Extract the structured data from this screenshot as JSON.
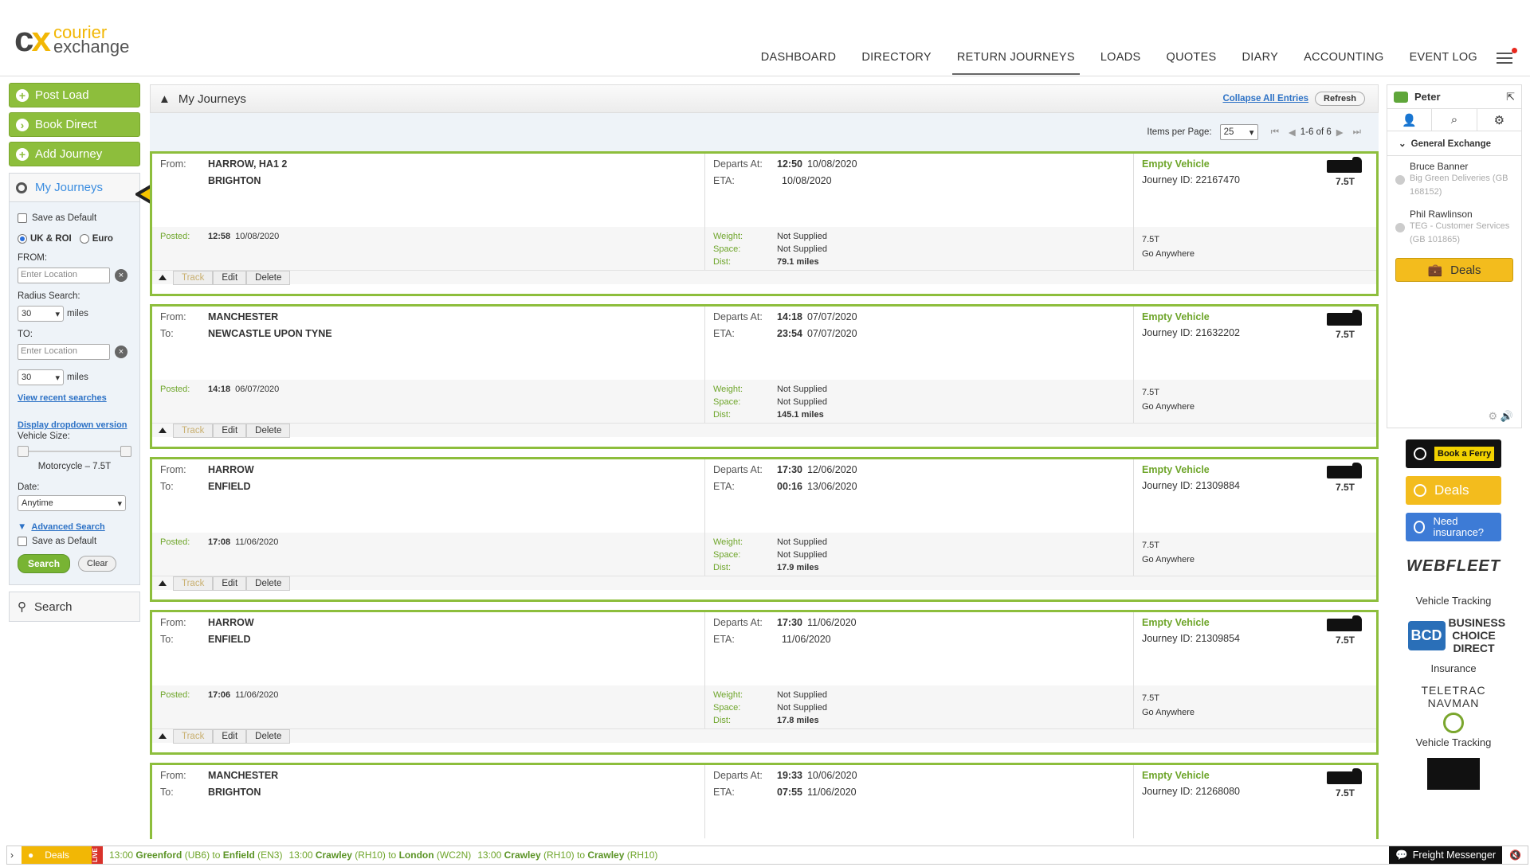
{
  "brand": {
    "cx": "cx",
    "line1": "courier",
    "line2": "exchange"
  },
  "nav": [
    {
      "label": "DASHBOARD"
    },
    {
      "label": "DIRECTORY"
    },
    {
      "label": "RETURN JOURNEYS",
      "active": true
    },
    {
      "label": "LOADS"
    },
    {
      "label": "QUOTES"
    },
    {
      "label": "DIARY"
    },
    {
      "label": "ACCOUNTING"
    },
    {
      "label": "EVENT LOG"
    }
  ],
  "sidebar": {
    "buttons": [
      "Post Load",
      "Book Direct",
      "Add Journey"
    ],
    "panel_title": "My Journeys",
    "save_default": "Save as Default",
    "uk_label": "UK & ROI",
    "euro_label": "Euro",
    "from_label": "FROM:",
    "from_placeholder": "Enter Location",
    "radius_label": "Radius Search:",
    "radius_value": "30",
    "miles": "miles",
    "to_label": "TO:",
    "to_placeholder": "Enter Location",
    "to_radius": "30",
    "recent": "View recent searches",
    "dropdown": "Display dropdown version",
    "vehicle_label": "Vehicle Size:",
    "vehicle_range": "Motorcycle – 7.5T",
    "date_label": "Date:",
    "date_value": "Anytime",
    "advanced": "Advanced Search",
    "save_default2": "Save as Default",
    "search_btn": "Search",
    "clear_btn": "Clear",
    "search_panel": "Search"
  },
  "main": {
    "title": "My Journeys",
    "collapse": "Collapse All Entries",
    "refresh": "Refresh",
    "per_page_label": "Items per Page:",
    "per_page": "25",
    "range": "1-6 of 6"
  },
  "labels": {
    "from": "From:",
    "to": "To:",
    "departs": "Departs At:",
    "eta": "ETA:",
    "posted": "Posted:",
    "weight": "Weight:",
    "space": "Space:",
    "dist": "Dist:",
    "track": "Track",
    "edit": "Edit",
    "delete": "Delete"
  },
  "journeys": [
    {
      "from": "HARROW, HA1 2",
      "to": "BRIGHTON",
      "to_label": "",
      "dep_time": "12:50",
      "dep_date": "10/08/2020",
      "eta_time": "",
      "eta_date": "10/08/2020",
      "posted_time": "12:58",
      "posted_date": "10/08/2020",
      "weight": "Not Supplied",
      "space": "Not Supplied",
      "dist": "79.1 miles",
      "status": "Empty Vehicle",
      "jid": "Journey ID: 22167470",
      "size": "7.5T",
      "vsize": "7.5T",
      "note": "Go Anywhere"
    },
    {
      "from": "MANCHESTER",
      "to": "NEWCASTLE UPON TYNE",
      "to_label": "To:",
      "dep_time": "14:18",
      "dep_date": "07/07/2020",
      "eta_time": "23:54",
      "eta_date": "07/07/2020",
      "posted_time": "14:18",
      "posted_date": "06/07/2020",
      "weight": "Not Supplied",
      "space": "Not Supplied",
      "dist": "145.1 miles",
      "status": "Empty Vehicle",
      "jid": "Journey ID: 21632202",
      "size": "7.5T",
      "vsize": "7.5T",
      "note": "Go Anywhere"
    },
    {
      "from": "HARROW",
      "to": "ENFIELD",
      "to_label": "To:",
      "dep_time": "17:30",
      "dep_date": "12/06/2020",
      "eta_time": "00:16",
      "eta_date": "13/06/2020",
      "posted_time": "17:08",
      "posted_date": "11/06/2020",
      "weight": "Not Supplied",
      "space": "Not Supplied",
      "dist": "17.9 miles",
      "status": "Empty Vehicle",
      "jid": "Journey ID: 21309884",
      "size": "7.5T",
      "vsize": "7.5T",
      "note": "Go Anywhere"
    },
    {
      "from": "HARROW",
      "to": "ENFIELD",
      "to_label": "To:",
      "dep_time": "17:30",
      "dep_date": "11/06/2020",
      "eta_time": "",
      "eta_date": "11/06/2020",
      "posted_time": "17:06",
      "posted_date": "11/06/2020",
      "weight": "Not Supplied",
      "space": "Not Supplied",
      "dist": "17.8 miles",
      "status": "Empty Vehicle",
      "jid": "Journey ID: 21309854",
      "size": "7.5T",
      "vsize": "7.5T",
      "note": "Go Anywhere"
    },
    {
      "from": "MANCHESTER",
      "to": "BRIGHTON",
      "to_label": "To:",
      "dep_time": "19:33",
      "dep_date": "10/06/2020",
      "eta_time": "07:55",
      "eta_date": "11/06/2020",
      "posted_time": "",
      "posted_date": "",
      "weight": "",
      "space": "",
      "dist": "",
      "status": "Empty Vehicle",
      "jid": "Journey ID: 21268080",
      "size": "7.5T",
      "vsize": "",
      "note": ""
    }
  ],
  "chat": {
    "user": "Peter",
    "group": "General Exchange",
    "contacts": [
      {
        "name": "Bruce Banner",
        "sub": "Big Green Deliveries (GB 168152)"
      },
      {
        "name": "Phil Rawlinson",
        "sub": "TEG - Customer Services (GB 101865)"
      }
    ],
    "deals": "Deals"
  },
  "ads": {
    "ferry": "Book a Ferry",
    "deals": "Deals",
    "insurance": "Need insurance?",
    "webfleet": "WEBFLEET",
    "webfleet_sub": "Vehicle Tracking",
    "bcd": "BCD",
    "bcd_text": "BUSINESS CHOICE DIRECT",
    "bcd_sub": "Insurance",
    "teletrac": "TELETRAC NAVMAN",
    "teletrac_sub": "Vehicle Tracking"
  },
  "ticker": {
    "deals": "Deals",
    "live": "LIVE",
    "messenger": "Freight Messenger",
    "items": [
      {
        "time": "13:00",
        "from": "Greenford",
        "fpc": "(UB6)",
        "to": "Enfield",
        "tpc": "(EN3)"
      },
      {
        "time": "13:00",
        "from": "Crawley",
        "fpc": "(RH10)",
        "to": "London",
        "tpc": "(WC2N)"
      },
      {
        "time": "13:00",
        "from": "Crawley",
        "fpc": "(RH10)",
        "to": "Crawley",
        "tpc": "(RH10)"
      }
    ]
  },
  "colors": {
    "green": "#8dbe3c",
    "yellow": "#f2b705",
    "link": "#2d72c6"
  }
}
